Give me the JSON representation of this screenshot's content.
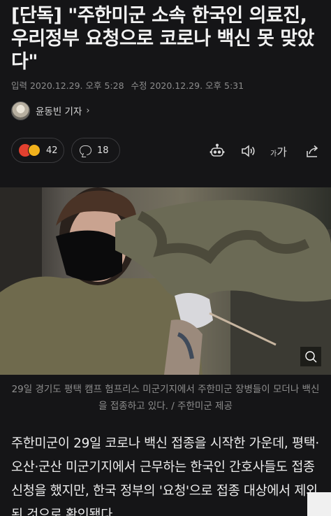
{
  "article": {
    "headline": "[단독] \"주한미군 소속 한국인 의료진, 우리정부 요청으로 코로나 백신 못 맞았다\"",
    "input_time": "입력 2020.12.29. 오후 5:28",
    "edit_time": "수정 2020.12.29. 오후 5:31",
    "reporter": "윤동빈 기자"
  },
  "actions": {
    "reaction_count": "42",
    "comment_count": "18",
    "font_size_small": "가",
    "font_size_big": "가"
  },
  "icons": {
    "reporter_chevron": "chevron-right-icon",
    "reaction": "angry-sad-emoji-icon",
    "comment": "speech-bubble-icon",
    "summary_bot": "robot-icon",
    "tts": "speaker-icon",
    "font_size": "font-size-icon",
    "share": "share-icon"
  },
  "photo": {
    "caption": "29일 경기도 평택 캠프 험프리스 미군기지에서 주한미군 장병들이 모더나 백신을 접종하고 있다. / 주한미군 제공"
  },
  "body": {
    "paragraph": "주한미군이 29일 코로나 백신 접종을 시작한 가운데, 평택·오산·군산 미군기지에서 근무하는 한국인 간호사들도 접종 신청을 했지만, 한국 정부의 '요청'으로 접종 대상에서 제외된 것으로 확인됐다."
  },
  "colors": {
    "background": "#151517",
    "headline": "#f2f2f2",
    "meta": "#8c8c8c",
    "angry": "#e2402f",
    "sad": "#f2b21c"
  }
}
